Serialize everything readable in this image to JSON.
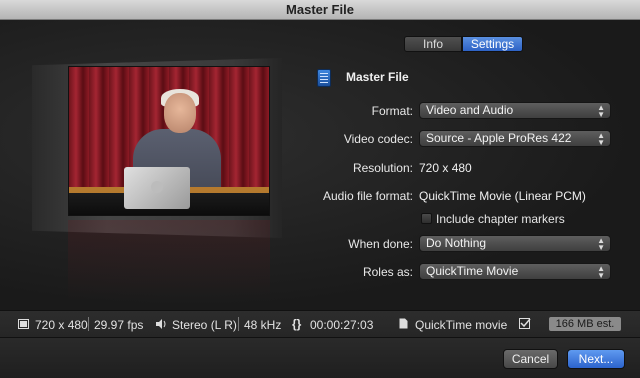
{
  "window": {
    "title": "Master File"
  },
  "tabs": [
    {
      "label": "Info",
      "selected": false
    },
    {
      "label": "Settings",
      "selected": true
    }
  ],
  "header": {
    "title": "Master File"
  },
  "form": {
    "format": {
      "label": "Format:",
      "value": "Video and Audio"
    },
    "video_codec": {
      "label": "Video codec:",
      "value": "Source - Apple ProRes 422"
    },
    "resolution": {
      "label": "Resolution:",
      "value": "720 x 480"
    },
    "audio_file_format": {
      "label": "Audio file format:",
      "value": "QuickTime Movie (Linear PCM)"
    },
    "chapter_markers": {
      "label": "Include chapter markers",
      "checked": false
    },
    "when_done": {
      "label": "When done:",
      "value": "Do Nothing"
    },
    "roles_as": {
      "label": "Roles as:",
      "value": "QuickTime Movie"
    }
  },
  "status": {
    "dimensions": "720 x 480",
    "fps": "29.97 fps",
    "audio": "Stereo (L R)",
    "sample_rate": "48 kHz",
    "duration": "00:00:27:03",
    "file_type": "QuickTime movie",
    "size_estimate": "166 MB est."
  },
  "buttons": {
    "cancel": "Cancel",
    "next": "Next..."
  },
  "icons": {
    "video": "film-frame-icon",
    "audio": "speaker-icon",
    "duration": "braces-icon",
    "file": "document-icon",
    "check": "checklist-icon",
    "master": "film-document-icon"
  },
  "colors": {
    "accent": "#3a74d8",
    "background": "#1e1e1e"
  }
}
